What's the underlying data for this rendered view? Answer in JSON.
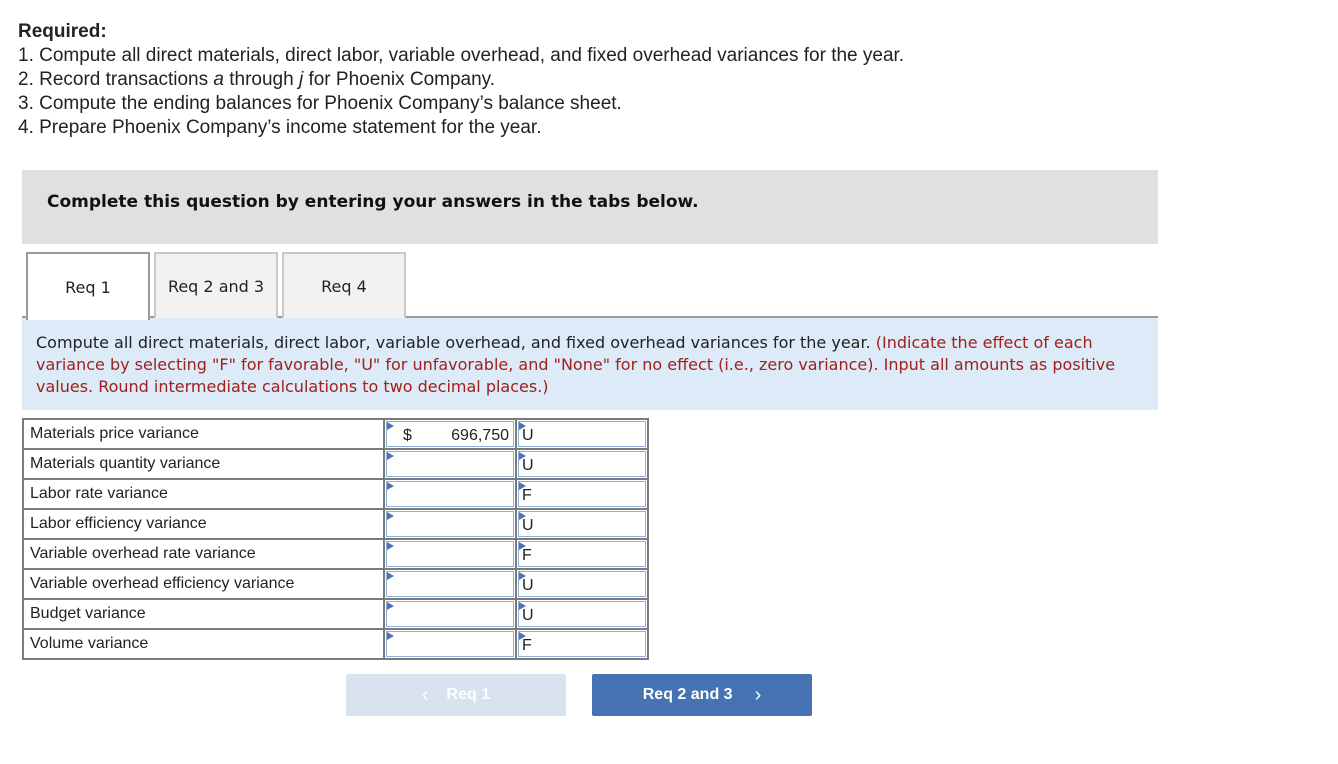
{
  "required": {
    "title": "Required:",
    "items": [
      {
        "prefix": "1. Compute all direct materials, direct labor, variable overhead, and fixed overhead variances for the year.",
        "italic1": "",
        "mid": "",
        "italic2": "",
        "suffix": ""
      },
      {
        "prefix": "2. Record transactions ",
        "italic1": "a",
        "mid": " through ",
        "italic2": "j",
        "suffix": " for Phoenix Company."
      },
      {
        "prefix": "3. Compute the ending balances for Phoenix Company’s balance sheet.",
        "italic1": "",
        "mid": "",
        "italic2": "",
        "suffix": ""
      },
      {
        "prefix": "4. Prepare Phoenix Company’s income statement for the year.",
        "italic1": "",
        "mid": "",
        "italic2": "",
        "suffix": ""
      }
    ]
  },
  "banner": "Complete this question by entering your answers in the tabs below.",
  "tabs": [
    {
      "label": "Req 1",
      "active": true
    },
    {
      "label": "Req 2 and 3",
      "active": false
    },
    {
      "label": "Req 4",
      "active": false
    }
  ],
  "instructions": {
    "main": "Compute all direct materials, direct labor, variable overhead, and fixed overhead variances for the year. ",
    "note": "(Indicate the effect of each variance by selecting \"F\" for favorable, \"U\" for unfavorable, and \"None\" for no effect (i.e., zero variance). Input all amounts as positive values. Round intermediate calculations to two decimal places.)"
  },
  "variances": [
    {
      "label": "Materials price variance",
      "currency": "$",
      "amount": "696,750",
      "effect": "U"
    },
    {
      "label": "Materials quantity variance",
      "currency": "",
      "amount": "",
      "effect": "U"
    },
    {
      "label": "Labor rate variance",
      "currency": "",
      "amount": "",
      "effect": "F"
    },
    {
      "label": "Labor efficiency variance",
      "currency": "",
      "amount": "",
      "effect": "U"
    },
    {
      "label": "Variable overhead rate variance",
      "currency": "",
      "amount": "",
      "effect": "F"
    },
    {
      "label": "Variable overhead efficiency variance",
      "currency": "",
      "amount": "",
      "effect": "U"
    },
    {
      "label": "Budget variance",
      "currency": "",
      "amount": "",
      "effect": "U"
    },
    {
      "label": "Volume variance",
      "currency": "",
      "amount": "",
      "effect": "F"
    }
  ],
  "nav": {
    "prev_label": "Req 1",
    "prev_icon": "‹",
    "next_label": "Req 2 and 3",
    "next_icon": "›"
  }
}
